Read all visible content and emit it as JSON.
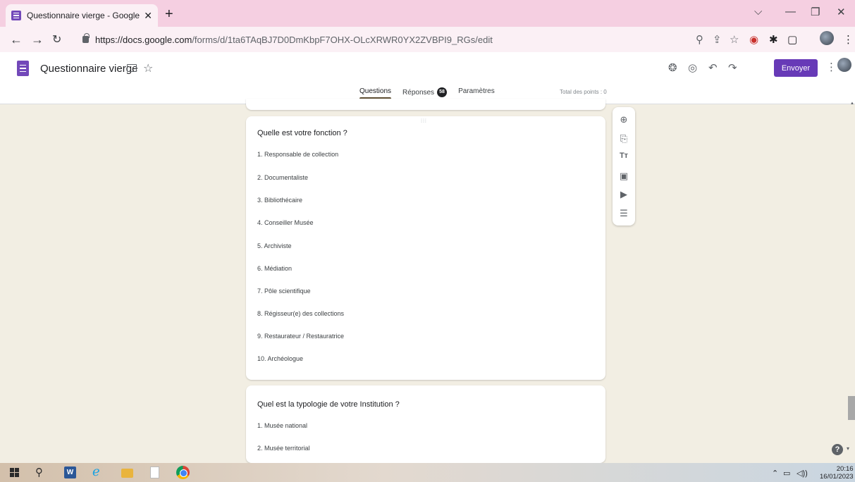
{
  "browser": {
    "tab_title": "Questionnaire vierge - Google Fo",
    "url_host": "https://docs.google.com",
    "url_path": "/forms/d/1ta6TAqBJ7D0DmKbpF7OHX-OLcXRWR0YX2ZVBPI9_RGs/edit"
  },
  "header": {
    "title": "Questionnaire vierge",
    "send_label": "Envoyer"
  },
  "tabs": {
    "questions": "Questions",
    "responses": "Réponses",
    "responses_count": "58",
    "settings": "Paramètres"
  },
  "points_label": "Total des points : 0",
  "questions": [
    {
      "title": "Quelle est votre fonction ?",
      "options": [
        "1.  Responsable de collection",
        "2.  Documentaliste",
        "3.  Bibliothécaire",
        "4.  Conseiller Musée",
        "5.  Archiviste",
        "6.  Médiation",
        "7.  Pôle scientifique",
        "8.  Régisseur(e) des collections",
        "9.  Restaurateur / Restauratrice",
        "10.  Archéologue"
      ]
    },
    {
      "title": "Quel est la typologie de votre Institution ?",
      "options": [
        "1.  Musée national",
        "2.  Musée territorial"
      ]
    }
  ],
  "taskbar": {
    "time": "20:16",
    "date": "16/01/2023"
  },
  "colors": {
    "accent": "#673ab7",
    "background": "#f2eee3",
    "tab_strip": "#f5cfe1"
  }
}
